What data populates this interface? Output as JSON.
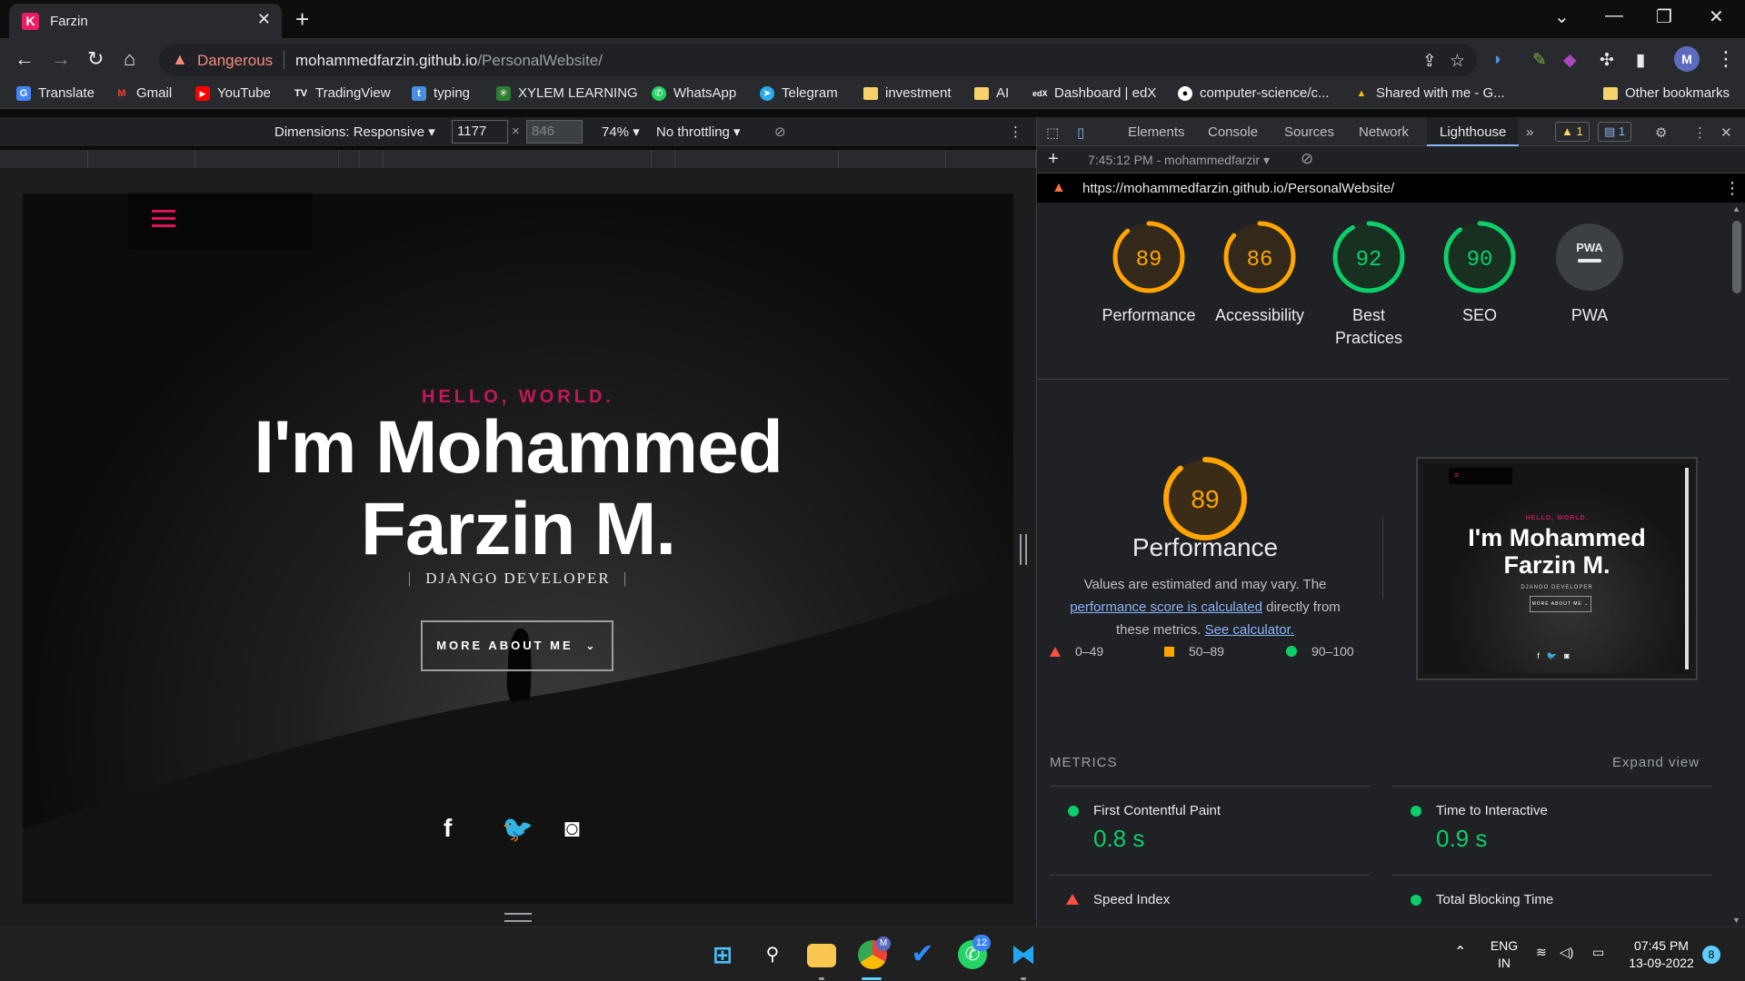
{
  "browser": {
    "tab_title": "Farzin",
    "tab_favicon_letter": "K",
    "security_label": "Dangerous",
    "url_host": "mohammedfarzin.github.io",
    "url_path": "/PersonalWebsite/",
    "profile_initial": "M"
  },
  "bookmarks": [
    {
      "label": "Translate",
      "icon": "translate-icon",
      "color": "#4285f4"
    },
    {
      "label": "Gmail",
      "icon": "gmail-icon",
      "color": "#ea4335"
    },
    {
      "label": "YouTube",
      "icon": "youtube-icon",
      "color": "#ff0000"
    },
    {
      "label": "TradingView",
      "icon": "tradingview-icon",
      "color": "#ffffff"
    },
    {
      "label": "typing",
      "icon": "typing-icon",
      "color": "#4a90e2"
    },
    {
      "label": "XYLEM LEARNING",
      "icon": "xylem-icon",
      "color": "#2e7d32"
    },
    {
      "label": "WhatsApp",
      "icon": "whatsapp-icon",
      "color": "#25d366"
    },
    {
      "label": "Telegram",
      "icon": "telegram-icon",
      "color": "#2aabee"
    },
    {
      "label": "investment",
      "icon": "folder-icon"
    },
    {
      "label": "AI",
      "icon": "folder-icon"
    },
    {
      "label": "Dashboard | edX",
      "icon": "edx-icon"
    },
    {
      "label": "computer-science/c...",
      "icon": "github-icon"
    },
    {
      "label": "Shared with me - G...",
      "icon": "drive-icon"
    },
    {
      "label": "Other bookmarks",
      "icon": "folder-icon"
    }
  ],
  "device_toolbar": {
    "dimensions_label": "Dimensions: Responsive",
    "width": "1177",
    "height": "846",
    "zoom": "74%",
    "throttling": "No throttling"
  },
  "page": {
    "greeting": "HELLO, WORLD.",
    "name_line1": "I'm Mohammed",
    "name_line2": "Farzin M.",
    "role": "DJANGO DEVELOPER",
    "cta": "MORE ABOUT ME",
    "social": [
      "facebook-icon",
      "twitter-icon",
      "instagram-icon"
    ],
    "accent_color": "#c2185b"
  },
  "devtools": {
    "tabs": [
      "Elements",
      "Console",
      "Sources",
      "Network",
      "Lighthouse"
    ],
    "active_tab": "Lighthouse",
    "warnings_count": "1",
    "issues_count": "1",
    "report_time": "7:45:12 PM - mohammedfarzir",
    "report_url": "https://mohammedfarzin.github.io/PersonalWebsite/",
    "scores": [
      {
        "label": "Performance",
        "score": 89,
        "display": "89",
        "color": "#ffa400"
      },
      {
        "label": "Accessibility",
        "score": 86,
        "display": "86",
        "color": "#ffa400"
      },
      {
        "label": "Best Practices",
        "score": 92,
        "display": "92",
        "color": "#0cce6b"
      },
      {
        "label": "SEO",
        "score": 90,
        "display": "90",
        "color": "#0cce6b"
      },
      {
        "label": "PWA",
        "score": null,
        "display": "PWA",
        "color": "#9aa0a6"
      }
    ],
    "perf_detail": {
      "score": "89",
      "score_value": 89,
      "title": "Performance",
      "note_prefix": "Values are estimated and may vary. The",
      "note_link1": "performance score is calculated",
      "note_middle": "directly from these metrics.",
      "note_link2": "See calculator.",
      "legend": [
        "0–49",
        "50–89",
        "90–100"
      ]
    },
    "thumbnail": {
      "greeting": "HELLO, WORLD.",
      "name_line1": "I'm Mohammed",
      "name_line2": "Farzin M.",
      "role": "DJANGO DEVELOPER",
      "cta": "MORE ABOUT ME"
    },
    "metrics_header": "METRICS",
    "expand_view": "Expand view",
    "metrics": [
      {
        "title": "First Contentful Paint",
        "value": "0.8 s",
        "status": "pass"
      },
      {
        "title": "Time to Interactive",
        "value": "0.9 s",
        "status": "pass"
      },
      {
        "title": "Speed Index",
        "value": "",
        "status": "fail"
      },
      {
        "title": "Total Blocking Time",
        "value": "",
        "status": "pass"
      }
    ]
  },
  "taskbar": {
    "language": "ENG",
    "region": "IN",
    "time": "07:45 PM",
    "date": "13-09-2022",
    "whatsapp_badge": "12",
    "chrome_badge": "M",
    "notification_count": "8"
  }
}
